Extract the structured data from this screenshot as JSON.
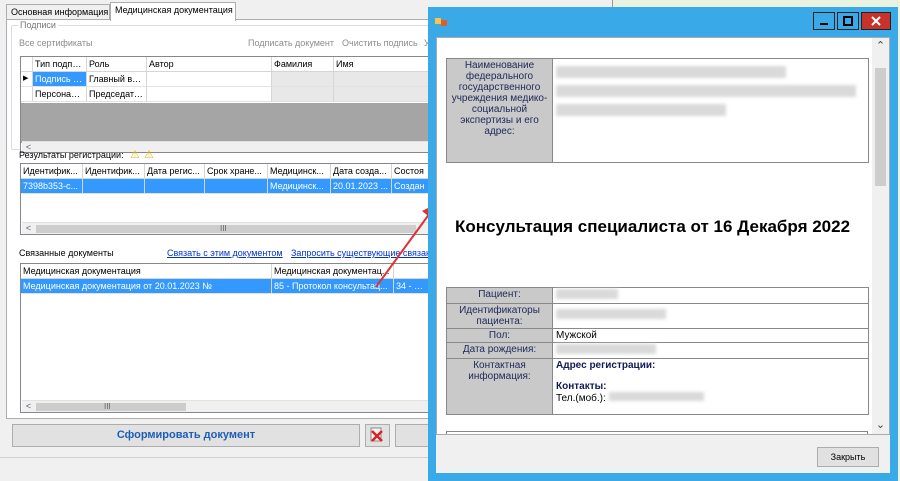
{
  "tabs": [
    {
      "label": "Основная информация"
    },
    {
      "label": "Медицинская документация"
    }
  ],
  "signatures": {
    "legend": "Подписи",
    "all_certs": "Все сертификаты",
    "sign_doc": "Подписать документ",
    "clear_signature": "Очистить подпись",
    "columns": [
      "Тип подписи",
      "Роль",
      "Автор",
      "Фамилия",
      "Имя"
    ],
    "rows": [
      [
        "Подпись ме...",
        "Главный врач",
        "",
        "",
        ""
      ],
      [
        "Персональн...",
        "Председате...",
        "",
        "",
        ""
      ]
    ]
  },
  "registration": {
    "label": "Результаты регистрации:",
    "columns": [
      "Идентифик...",
      "Идентифик...",
      "Дата регис...",
      "Срок хране...",
      "Медицинск...",
      "Дата созда...",
      "Состоя"
    ],
    "rows": [
      [
        "7398b353-c...",
        "",
        "",
        "",
        "Медицинск...",
        "20.01.2023 ...",
        "Создан"
      ]
    ]
  },
  "linked": {
    "label": "Связанные документы",
    "link_to_doc": "Связать с этим документом",
    "request_existing": "Запросить существующие связан",
    "columns": [
      "Медицинская документация",
      "Медицинская документац...",
      ""
    ],
    "rows": [
      [
        "Медицинская документация от 20.01.2023 №",
        "85 - Протокол консультац...",
        "34 - МСЭ"
      ]
    ]
  },
  "buttons": {
    "form_document": "Сформировать документ",
    "close": "Закрыть"
  },
  "modal": {
    "heading": "Консультация специалиста от 16 Декабря 2022",
    "org_label": "Наименование федерального государственного учреждения медико-социальной экспертизы и его адрес:",
    "patient_label": "Пациент:",
    "ids_label": "Идентификаторы пациента:",
    "sex_label": "Пол:",
    "sex_value": "Мужской",
    "dob_label": "Дата рождения:",
    "contact_label": "Контактная информация:",
    "reg_address": "Адрес регистрации:",
    "contacts": "Контакты:",
    "phone": "Тел.(моб.):"
  },
  "scroll_glyph": "III",
  "colors": {
    "selection": "#3399ff",
    "window_frame": "#3aa9e8",
    "close_red": "#c7322b",
    "arrow": "#e03030"
  }
}
